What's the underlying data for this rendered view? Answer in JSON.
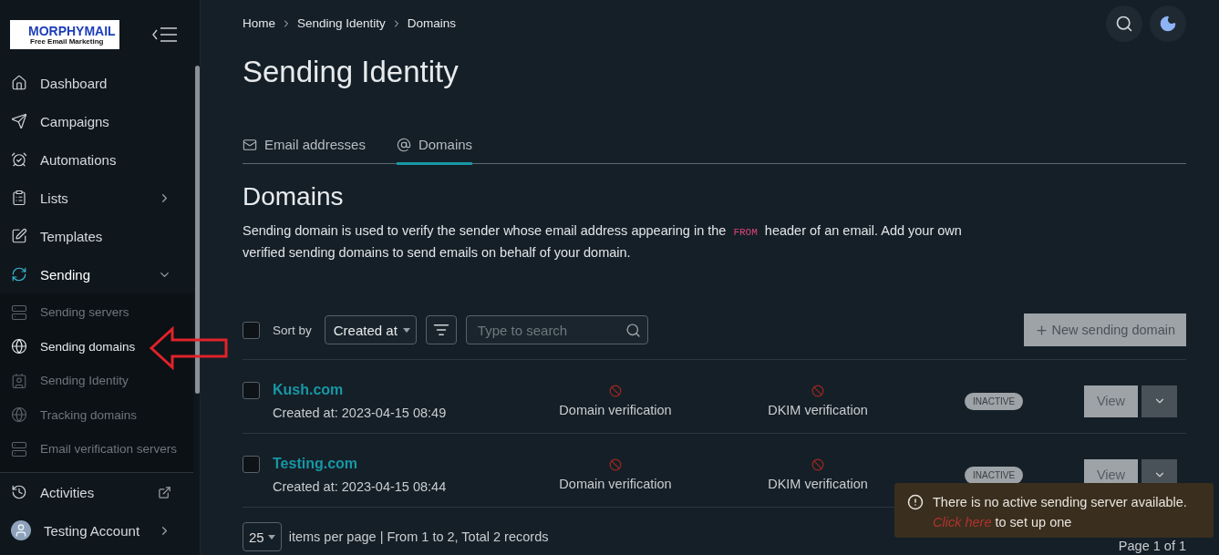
{
  "logo": {
    "title": "MORPHYMAIL",
    "subtitle": "Free Email Marketing"
  },
  "sidebar": {
    "items": [
      {
        "label": "Dashboard",
        "kind": "link"
      },
      {
        "label": "Campaigns",
        "kind": "link"
      },
      {
        "label": "Automations",
        "kind": "link"
      },
      {
        "label": "Lists",
        "kind": "group",
        "expanded": false
      },
      {
        "label": "Templates",
        "kind": "link"
      },
      {
        "label": "Sending",
        "kind": "group",
        "expanded": true,
        "children": [
          {
            "label": "Sending servers",
            "selected": false
          },
          {
            "label": "Sending domains",
            "selected": true
          },
          {
            "label": "Sending Identity",
            "selected": false
          },
          {
            "label": "Tracking domains",
            "selected": false
          },
          {
            "label": "Email verification servers",
            "selected": false
          }
        ]
      }
    ],
    "footer": [
      {
        "label": "Activities",
        "kind": "external"
      },
      {
        "label": "Testing Account",
        "kind": "account"
      }
    ]
  },
  "breadcrumbs": [
    "Home",
    "Sending Identity",
    "Domains"
  ],
  "page_title": "Sending Identity",
  "tabs": [
    {
      "label": "Email addresses",
      "selected": false
    },
    {
      "label": "Domains",
      "selected": true
    }
  ],
  "section": {
    "heading": "Domains",
    "description_before": "Sending domain is used to verify the sender whose email address appearing in the",
    "description_code": "FROM",
    "description_after": "header of an email. Add your own verified sending domains to send emails on behalf of your domain."
  },
  "toolbar": {
    "select_all": false,
    "sort_label": "Sort by",
    "sort_value": "Created at",
    "search_placeholder": "Type to search",
    "new_button": "New sending domain"
  },
  "rows": [
    {
      "name": "Kush.com",
      "created": "Created at: 2023-04-15 08:49",
      "checked": false,
      "checks": [
        {
          "label": "Domain verification",
          "verified": false
        },
        {
          "label": "DKIM verification",
          "verified": false
        }
      ],
      "status": "INACTIVE",
      "active": false,
      "view": "View"
    },
    {
      "name": "Testing.com",
      "created": "Created at: 2023-04-15 08:44",
      "checked": false,
      "checks": [
        {
          "label": "Domain verification",
          "verified": false
        },
        {
          "label": "DKIM verification",
          "verified": false
        }
      ],
      "status": "INACTIVE",
      "active": false,
      "view": "View"
    }
  ],
  "pagination": {
    "per_page": "25",
    "summary": "items per page | From 1 to 2, Total 2 records",
    "page": "Page 1 of 1"
  },
  "toast": {
    "before": "There is no active sending server available.",
    "link": "Click here",
    "after": "to set up one"
  }
}
